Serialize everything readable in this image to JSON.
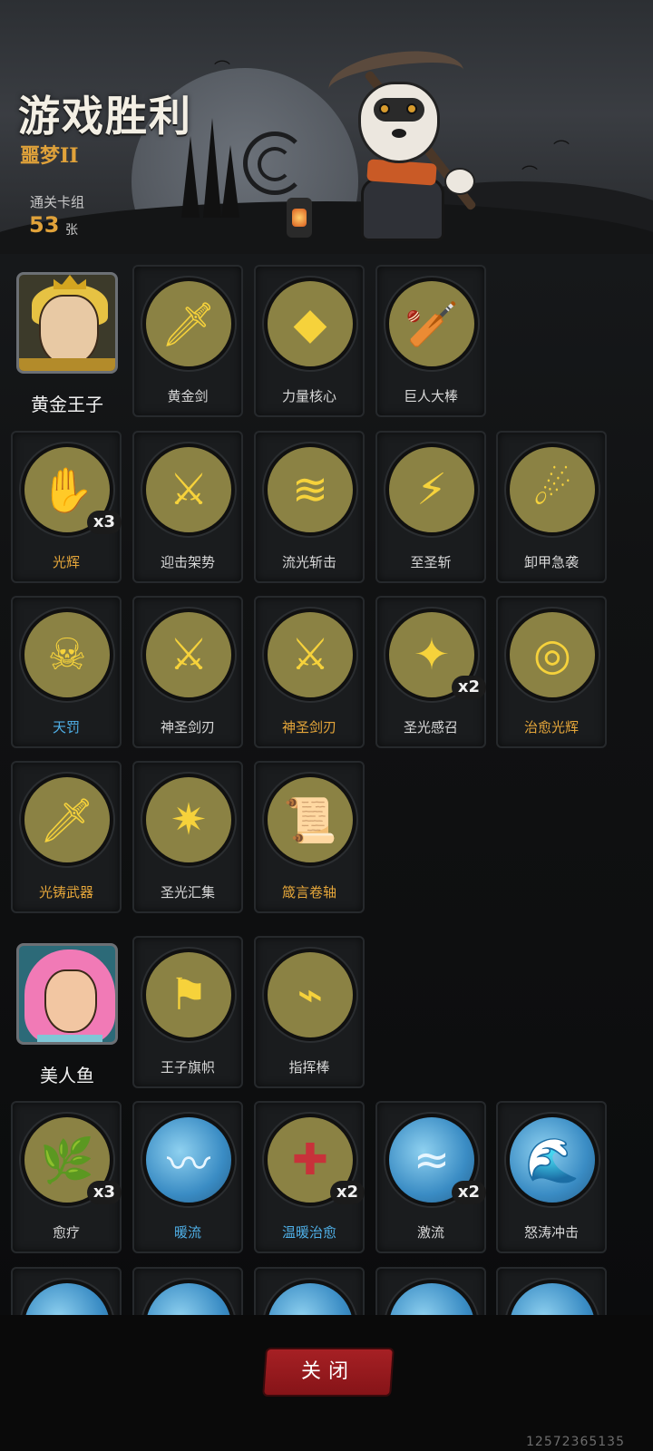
{
  "header": {
    "title": "游戏胜利",
    "difficulty": "噩梦II",
    "deck_label": "通关卡组",
    "deck_count": "53",
    "deck_unit": "张"
  },
  "sections": [
    {
      "hero": {
        "name": "黄金王子",
        "icon": "prince-portrait"
      },
      "rows": [
        [
          {
            "label": "黄金剑",
            "color": "white",
            "icon": "golden-sword-icon"
          },
          {
            "label": "力量核心",
            "color": "white",
            "icon": "power-core-icon"
          },
          {
            "label": "巨人大棒",
            "color": "white",
            "icon": "giant-club-icon"
          }
        ],
        [
          {
            "label": "光辉",
            "color": "gold",
            "mult": "x3",
            "icon": "radiance-icon"
          },
          {
            "label": "迎击架势",
            "color": "white",
            "icon": "parry-stance-icon"
          },
          {
            "label": "流光斩击",
            "color": "white",
            "icon": "light-slash-icon"
          },
          {
            "label": "至圣斩",
            "color": "white",
            "icon": "holy-strike-icon"
          },
          {
            "label": "卸甲急袭",
            "color": "white",
            "icon": "disarm-raid-icon"
          }
        ],
        [
          {
            "label": "天罚",
            "color": "blue",
            "icon": "divine-punishment-icon"
          },
          {
            "label": "神圣剑刃",
            "color": "white",
            "icon": "holy-blade-icon"
          },
          {
            "label": "神圣剑刃",
            "color": "gold",
            "icon": "holy-blade-icon"
          },
          {
            "label": "圣光感召",
            "color": "white",
            "mult": "x2",
            "icon": "holy-calling-icon"
          },
          {
            "label": "治愈光辉",
            "color": "gold",
            "icon": "healing-radiance-icon"
          }
        ],
        [
          {
            "label": "光铸武器",
            "color": "gold",
            "icon": "light-forged-weapon-icon"
          },
          {
            "label": "圣光汇集",
            "color": "white",
            "icon": "holy-gather-icon"
          },
          {
            "label": "箴言卷轴",
            "color": "gold",
            "icon": "proverb-scroll-icon"
          }
        ]
      ]
    },
    {
      "hero": {
        "name": "美人鱼",
        "icon": "mermaid-portrait"
      },
      "rows": [
        [
          {
            "label": "王子旗帜",
            "color": "white",
            "icon": "prince-banner-icon"
          },
          {
            "label": "指挥棒",
            "color": "white",
            "icon": "baton-icon"
          }
        ],
        [
          {
            "label": "愈疗",
            "color": "white",
            "mult": "x3",
            "icon": "heal-icon"
          },
          {
            "label": "暖流",
            "color": "blue",
            "icon": "warm-current-icon"
          },
          {
            "label": "温暖治愈",
            "color": "blue",
            "mult": "x2",
            "icon": "warm-heal-icon"
          },
          {
            "label": "激流",
            "color": "white",
            "mult": "x2",
            "icon": "torrent-icon"
          },
          {
            "label": "怒涛冲击",
            "color": "white",
            "icon": "raging-wave-icon"
          }
        ],
        [
          {
            "label": "",
            "color": "white",
            "icon": "water-card-icon"
          },
          {
            "label": "",
            "color": "white",
            "icon": "water-card-icon"
          },
          {
            "label": "",
            "color": "white",
            "icon": "water-card-icon"
          },
          {
            "label": "",
            "color": "white",
            "icon": "water-card-icon"
          },
          {
            "label": "",
            "color": "white",
            "icon": "water-card-icon"
          }
        ]
      ]
    }
  ],
  "close_button": "关闭",
  "build_id": "12572365135",
  "colors": {
    "gold": "#e5a63a",
    "blue": "#4fb0e8",
    "close": "#a62024"
  }
}
